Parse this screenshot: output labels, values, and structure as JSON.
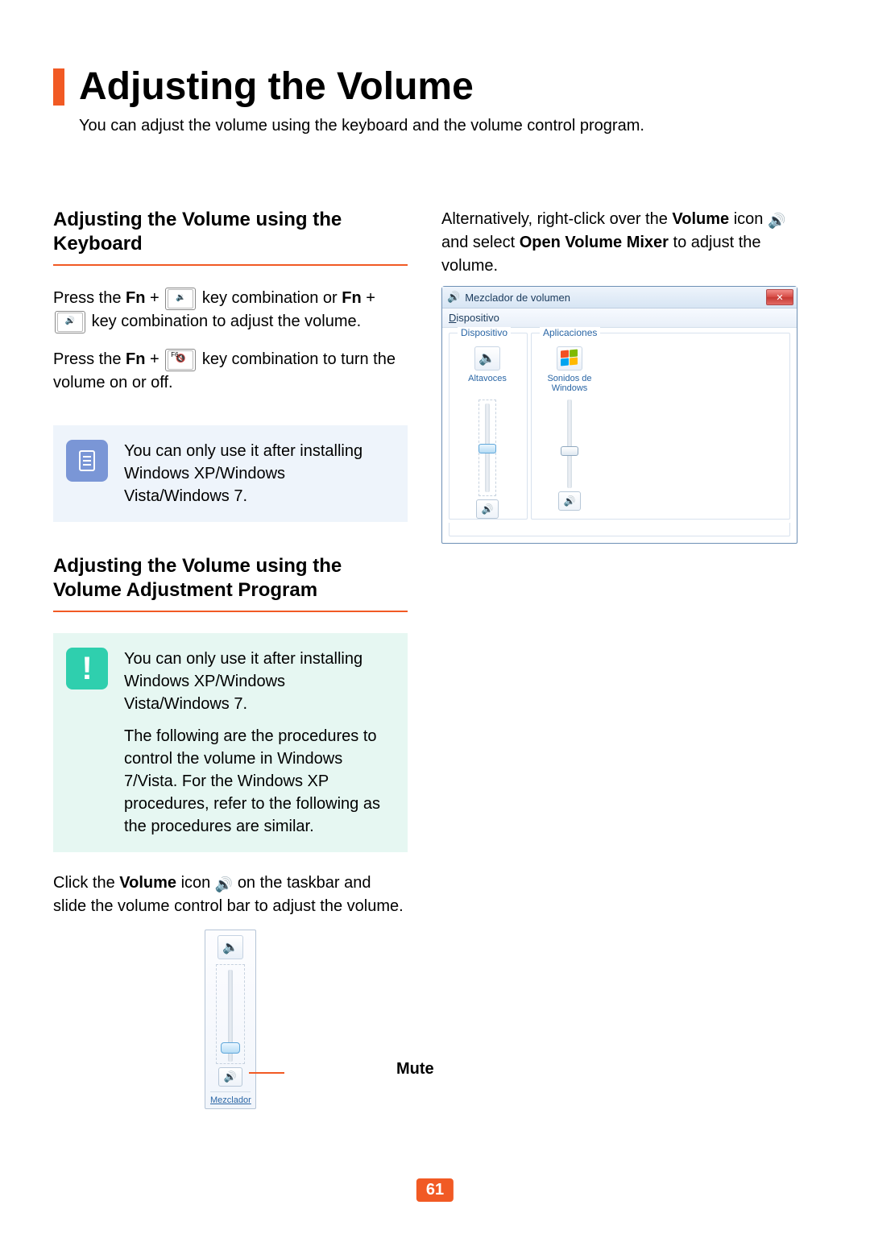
{
  "title": "Adjusting the Volume",
  "intro": "You can adjust the volume using the keyboard and the volume control program.",
  "left": {
    "h1": "Adjusting the Volume using the Keyboard",
    "p1a": "Press the ",
    "fn": "Fn",
    "p1b": " + ",
    "p1c": " key combination or ",
    "p1d": " + ",
    "p1e": " key combination to adjust the volume.",
    "p2a": "Press the ",
    "p2b": " + ",
    "p2c": " key combination to turn the volume on or off.",
    "note1": "You can only use it after installing Windows XP/Windows Vista/Windows 7.",
    "h2": "Adjusting the Volume using the Volume Adjustment Program",
    "note2a": "You can only use it after installing Windows XP/Windows Vista/Windows 7.",
    "note2b": "The following are the procedures to control the volume in Windows 7/Vista. For the Windows XP procedures, refer to the following as the procedures are similar.",
    "p3a": "Click the ",
    "p3b": "Volume",
    "p3c": " icon ",
    "p3d": " on the taskbar and slide the volume control bar to adjust the volume.",
    "mute_label": "Mute",
    "mixer_link": "Mezclador"
  },
  "right": {
    "p1a": "Alternatively, right-click over the ",
    "p1b": "Volume",
    "p1c": " icon ",
    "p1d": " and select ",
    "p1e": "Open Volume Mixer",
    "p1f": " to adjust the volume.",
    "window_title": "Mezclador de volumen",
    "menu_item": "Dispositivo",
    "group_device": "Dispositivo",
    "group_apps": "Aplicaciones",
    "item_speakers": "Altavoces",
    "item_system": "Sonidos de Windows"
  },
  "page_number": "61"
}
